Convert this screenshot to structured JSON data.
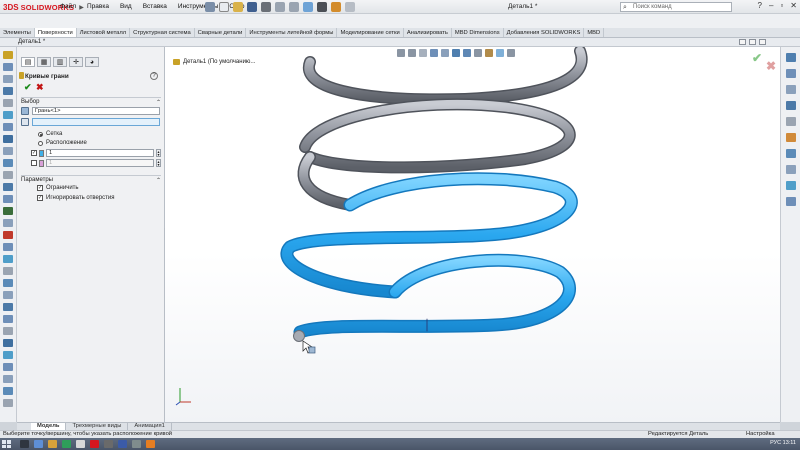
{
  "app": {
    "brand_prefix": "3DS",
    "brand_name": "SOLIDWORKS",
    "document_title": "Деталь1 *"
  },
  "menu": {
    "items": [
      "Файл",
      "Правка",
      "Вид",
      "Вставка",
      "Инструменты",
      "Окно"
    ]
  },
  "search": {
    "placeholder": "Поиск команд"
  },
  "command_tabs": [
    "Элементы",
    "Поверхности",
    "Листовой металл",
    "Структурная система",
    "Сварные детали",
    "Инструменты литейной формы",
    "Моделирование сетки",
    "Анализировать",
    "MBD Dimensions",
    "Добавления SOLIDWORKS",
    "MBD"
  ],
  "active_command_tab": "Поверхности",
  "document_tab": {
    "label": "Деталь1 *"
  },
  "property_manager": {
    "title": "Кривые грани",
    "ok_symbol": "✔",
    "cancel_symbol": "✖",
    "help_symbol": "?",
    "selection": {
      "header": "Выбор",
      "face_value": "Грань<1>",
      "vertex_value": "",
      "radio_options": [
        "Сетка",
        "Расположение"
      ],
      "selected_radio": "Сетка",
      "direction1_count": "1",
      "direction2_count": "1"
    },
    "parameters": {
      "header": "Параметры",
      "options": [
        {
          "label": "Ограничить",
          "checked": true
        },
        {
          "label": "Игнорировать отверстия",
          "checked": true
        }
      ]
    }
  },
  "viewport": {
    "tree_root": "Деталь1 (По умолчанию..."
  },
  "bottom_tabs": [
    "Модель",
    "Трехмерные виды",
    "Анимация1"
  ],
  "active_bottom_tab": "Модель",
  "status": {
    "message": "Выберите точку/вершину, чтобы указать расположение кривой",
    "mode": "Редактируется Деталь",
    "setting": "Настройка"
  },
  "taskbar": {
    "tray_text": "РУС  13:11"
  },
  "colors": {
    "spring_highlight": "#2aa7ef",
    "spring_gray": "#a8abb4",
    "brand_red": "#d6161f",
    "ok_green": "#1a8a1a",
    "cancel_red": "#c21414"
  }
}
